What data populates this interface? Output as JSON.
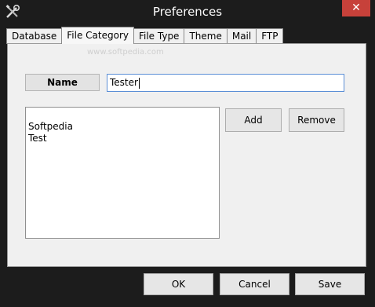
{
  "window": {
    "title": "Preferences",
    "close_glyph": "✕"
  },
  "tabs": [
    {
      "label": "Database"
    },
    {
      "label": "File Category"
    },
    {
      "label": "File Type"
    },
    {
      "label": "Theme"
    },
    {
      "label": "Mail"
    },
    {
      "label": "FTP"
    }
  ],
  "active_tab": "File Category",
  "panel": {
    "watermark": "www.softpedia.com",
    "name_label": "Name",
    "name_value": "Tester",
    "list_items": [
      "Softpedia",
      "Test"
    ],
    "add_label": "Add",
    "remove_label": "Remove"
  },
  "footer": {
    "ok_label": "OK",
    "cancel_label": "Cancel",
    "save_label": "Save"
  },
  "icons": {
    "app_icon": "tools-icon",
    "close_icon": "close-icon"
  },
  "colors": {
    "frame": "#1c1c1c",
    "close_button": "#c7413a",
    "input_focus_border": "#5b8fd6"
  }
}
